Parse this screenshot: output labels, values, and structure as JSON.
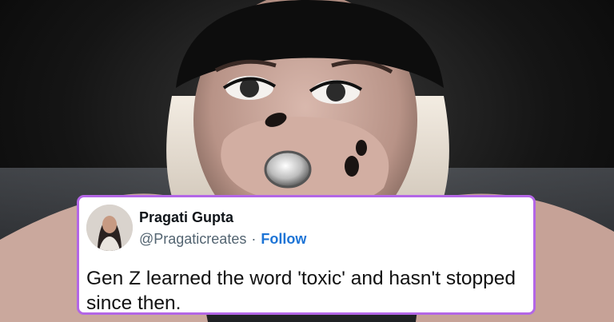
{
  "tweet": {
    "author_name": "Pragati Gupta",
    "handle": "@Pragaticreates",
    "separator": "·",
    "follow_label": "Follow",
    "text": "Gen Z learned the word 'toxic' and hasn't stopped since then."
  },
  "colors": {
    "card_border": "#b366e6",
    "follow_link": "#1d74d6",
    "handle_text": "#536471"
  },
  "icons": {
    "avatar": "profile-photo"
  }
}
